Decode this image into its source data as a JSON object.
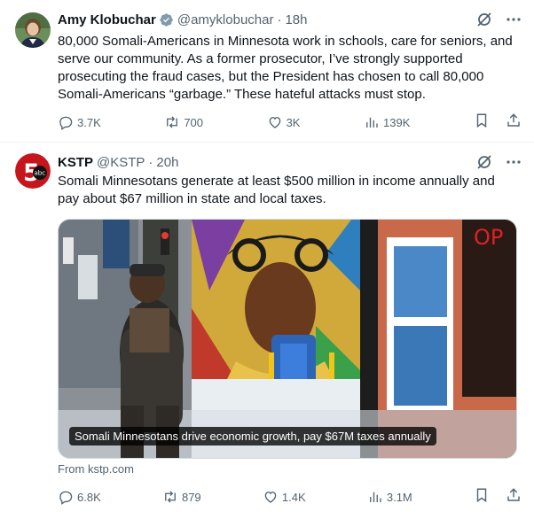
{
  "tweets": [
    {
      "author_name": "Amy Klobuchar",
      "handle": "@amyklobuchar",
      "separator": "·",
      "time": "18h",
      "verified": true,
      "text": "80,000 Somali-Americans in Minnesota work in schools, care for seniors, and serve our community. As a former prosecutor, I’ve strongly supported prosecuting the fraud cases, but the President has chosen to call 80,000 Somali-Americans “garbage.” These hateful attacks must stop.",
      "stats": {
        "replies": "3.7K",
        "reposts": "700",
        "likes": "3K",
        "views": "139K"
      }
    },
    {
      "author_name": "KSTP",
      "handle": "@KSTP",
      "separator": "·",
      "time": "20h",
      "text": "Somali Minnesotans generate at least $500 million in income annually and pay about $67 million in state and local taxes.",
      "media_caption": "Somali Minnesotans drive economic growth, pay $67M taxes annually",
      "avatar_logo_text": "abc",
      "avatar_numeral": "5",
      "source": "From kstp.com",
      "stats": {
        "replies": "6.8K",
        "reposts": "879",
        "likes": "1.4K",
        "views": "3.1M"
      }
    }
  ],
  "colors": {
    "text": "#0f1419",
    "muted": "#536471",
    "verified": "#829aab",
    "divider": "#eff3f4"
  },
  "icons": [
    "grok-icon",
    "more-icon",
    "reply-icon",
    "repost-icon",
    "like-icon",
    "views-icon",
    "bookmark-icon",
    "share-icon"
  ]
}
